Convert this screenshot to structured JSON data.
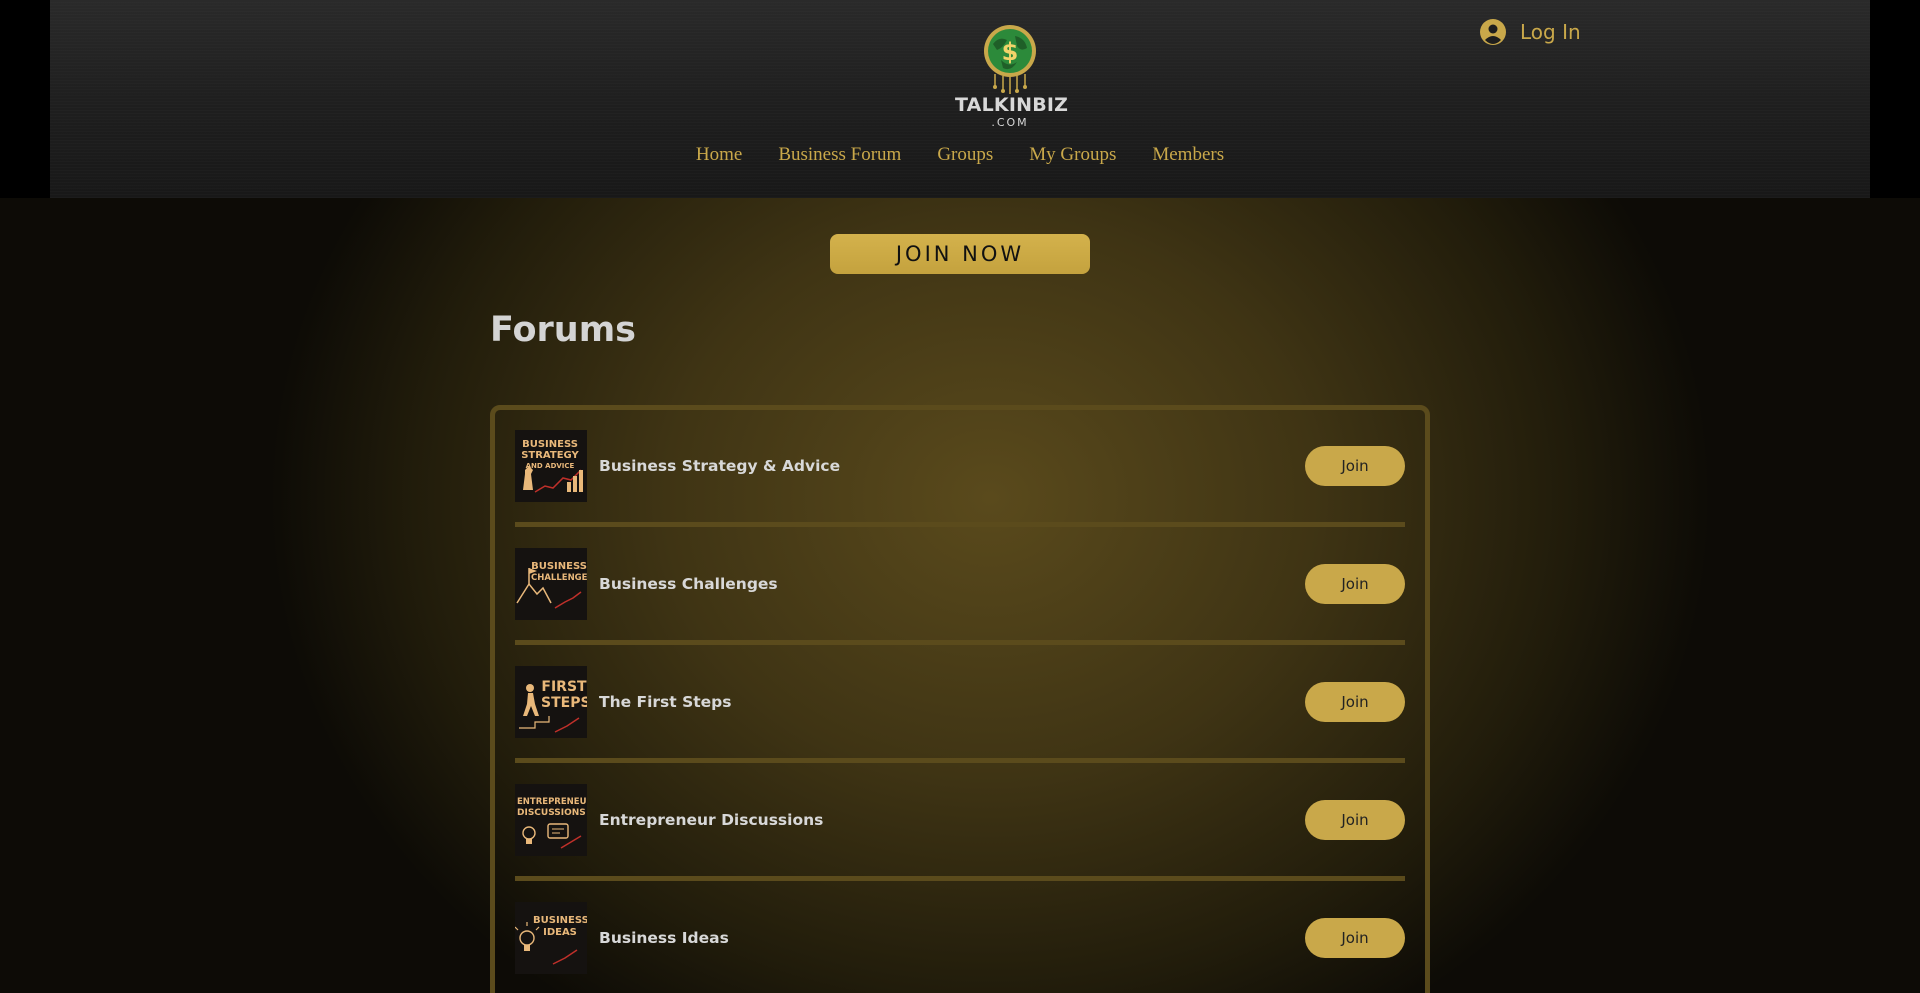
{
  "header": {
    "logo": {
      "name": "TALKINBIZ",
      "suffix": ".COM"
    },
    "login_label": "Log In",
    "nav": [
      "Home",
      "Business Forum",
      "Groups",
      "My Groups",
      "Members"
    ]
  },
  "main": {
    "join_now_label": "JOIN NOW",
    "title": "Forums",
    "forums": [
      {
        "name": "Business Strategy & Advice",
        "join_label": "Join",
        "thumb_lines": [
          "BUSINESS",
          "STRATEGY",
          "AND ADVICE"
        ]
      },
      {
        "name": "Business Challenges",
        "join_label": "Join",
        "thumb_lines": [
          "BUSINESS",
          "CHALLENGES"
        ]
      },
      {
        "name": "The First Steps",
        "join_label": "Join",
        "thumb_lines": [
          "FIRST",
          "STEPS"
        ]
      },
      {
        "name": "Entrepreneur Discussions",
        "join_label": "Join",
        "thumb_lines": [
          "ENTREPRENEUR",
          "DISCUSSIONS"
        ]
      },
      {
        "name": "Business Ideas",
        "join_label": "Join",
        "thumb_lines": [
          "BUSINESS",
          "IDEAS"
        ]
      }
    ]
  },
  "colors": {
    "accent_gold": "#c9a84a",
    "join_now_gold": "#d4b24c",
    "divider": "#5b4b1c",
    "text_light": "#d8d8d8"
  }
}
